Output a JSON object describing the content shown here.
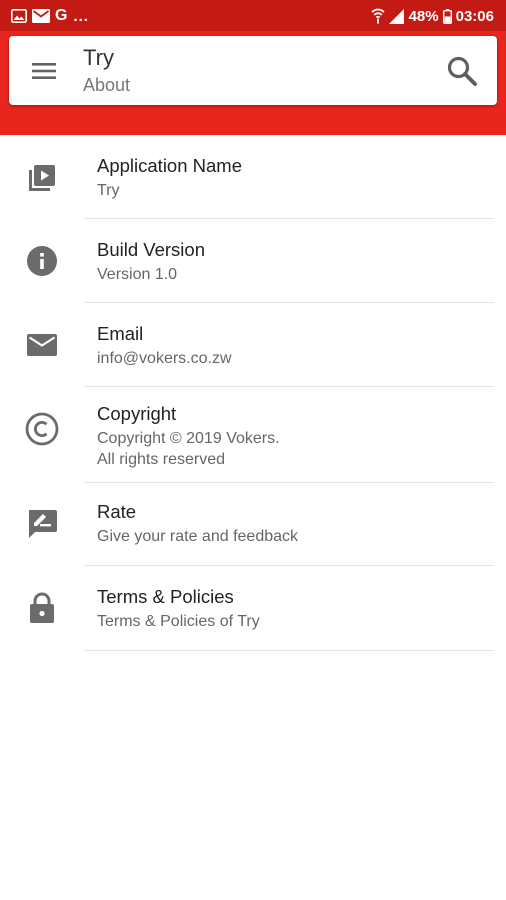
{
  "status_bar": {
    "left_dots": "...",
    "google_letter": "G",
    "battery": "48%",
    "time": "03:06",
    "icons": [
      "gallery-icon",
      "mail-icon",
      "google-icon",
      "wifi-icon",
      "signal-icon",
      "battery-icon"
    ]
  },
  "toolbar": {
    "title": "Try",
    "subtitle": "About",
    "menu_icon": "hamburger-menu-icon",
    "search_icon": "search-icon"
  },
  "items": [
    {
      "icon": "video-library-icon",
      "primary": "Application Name",
      "secondary": "Try"
    },
    {
      "icon": "info-icon",
      "primary": "Build Version",
      "secondary": "Version 1.0"
    },
    {
      "icon": "email-icon",
      "primary": "Email",
      "secondary": "info@vokers.co.zw"
    },
    {
      "icon": "copyright-icon",
      "primary": "Copyright",
      "secondary": "Copyright © 2019 Vokers.\n All rights reserved"
    },
    {
      "icon": "rate-review-icon",
      "primary": "Rate",
      "secondary": "Give your rate and feedback"
    },
    {
      "icon": "lock-icon",
      "primary": "Terms & Policies",
      "secondary": "Terms & Policies of Try"
    }
  ],
  "colors": {
    "status_bar": "#c41a14",
    "app_bar": "#e8261d",
    "icon_gray": "#6b6b6b",
    "divider": "#e3e3e3"
  }
}
